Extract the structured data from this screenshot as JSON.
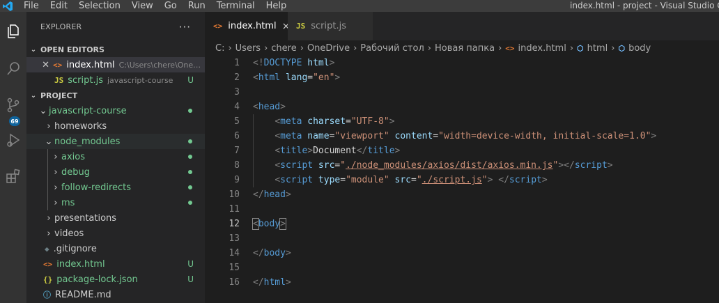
{
  "menu": [
    "File",
    "Edit",
    "Selection",
    "View",
    "Go",
    "Run",
    "Terminal",
    "Help"
  ],
  "window_title": "index.html - project - Visual Studio Code",
  "activity": {
    "scm_badge": "69"
  },
  "sidebar": {
    "title": "EXPLORER",
    "more": "···",
    "open_editors": {
      "title": "OPEN EDITORS",
      "items": [
        {
          "icon": "<>",
          "label": "index.html",
          "desc": "C:\\Users\\chere\\OneDrive\\Рабочий стол\\Новая папка"
        },
        {
          "icon": "JS",
          "label": "script.js",
          "desc": "javascript-course",
          "status": "U"
        }
      ]
    },
    "project": {
      "title": "PROJECT",
      "items": [
        {
          "label": "javascript-course"
        },
        {
          "label": "homeworks"
        },
        {
          "label": "node_modules"
        },
        {
          "label": "axios"
        },
        {
          "label": "debug"
        },
        {
          "label": "follow-redirects"
        },
        {
          "label": "ms"
        },
        {
          "label": "presentations"
        },
        {
          "label": "videos"
        },
        {
          "label": ".gitignore",
          "icon": "◆"
        },
        {
          "label": "index.html",
          "icon": "<>",
          "status": "U"
        },
        {
          "label": "package-lock.json",
          "icon": "{}",
          "status": "U"
        },
        {
          "label": "README.md",
          "icon": "ⓘ"
        }
      ]
    }
  },
  "tabs": [
    {
      "icon": "<>",
      "label": "index.html",
      "close": "×"
    },
    {
      "icon": "JS",
      "label": "script.js"
    }
  ],
  "breadcrumb": [
    "C:",
    "Users",
    "chere",
    "OneDrive",
    "Рабочий стол",
    "Новая папка",
    "index.html",
    "html",
    "body"
  ],
  "code": {
    "line_numbers": [
      "1",
      "2",
      "3",
      "4",
      "5",
      "6",
      "7",
      "8",
      "9",
      "10",
      "11",
      "12",
      "13",
      "14",
      "15",
      "16"
    ],
    "l1": {
      "open": "<!",
      "kw": "DOCTYPE",
      "val": " html",
      "close": ">"
    },
    "l2": {
      "lt": "<",
      "tag": "html",
      "attr": " lang",
      "eq": "=",
      "val": "\"en\"",
      "gt": ">"
    },
    "l4": {
      "lt": "<",
      "tag": "head",
      "gt": ">"
    },
    "l5": {
      "lt": "<",
      "tag": "meta",
      "attr": " charset",
      "eq": "=",
      "val": "\"UTF-8\"",
      "gt": ">"
    },
    "l6": {
      "lt": "<",
      "tag": "meta",
      "attr1": " name",
      "eq1": "=",
      "val1": "\"viewport\"",
      "attr2": " content",
      "eq2": "=",
      "val2": "\"width=device-width, initial-scale=1.0\"",
      "gt": ">"
    },
    "l7": {
      "lt": "<",
      "tag": "title",
      "gt": ">",
      "text": "Document",
      "lt2": "</",
      "tag2": "title",
      "gt2": ">"
    },
    "l8": {
      "lt": "<",
      "tag": "script",
      "attr": " src",
      "eq": "=",
      "q1": "\"",
      "path": "./node_modules/axios/dist/axios.min.js",
      "q2": "\"",
      "gt": ">",
      "lt2": "</",
      "tag2": "script",
      "gt2": ">"
    },
    "l9": {
      "lt": "<",
      "tag": "script",
      "attr1": " type",
      "eq1": "=",
      "val1": "\"module\"",
      "attr2": " src",
      "eq2": "=",
      "q1": "\"",
      "path": "./script.js",
      "q2": "\"",
      "gt": ">",
      "sp": " ",
      "lt2": "</",
      "tag2": "script",
      "gt2": ">"
    },
    "l10": {
      "lt": "</",
      "tag": "head",
      "gt": ">"
    },
    "l12": {
      "lt": "<",
      "tag": "body",
      "gt": ">"
    },
    "l14": {
      "lt": "</",
      "tag": "body",
      "gt": ">"
    },
    "l16": {
      "lt": "</",
      "tag": "html",
      "gt": ">"
    }
  }
}
